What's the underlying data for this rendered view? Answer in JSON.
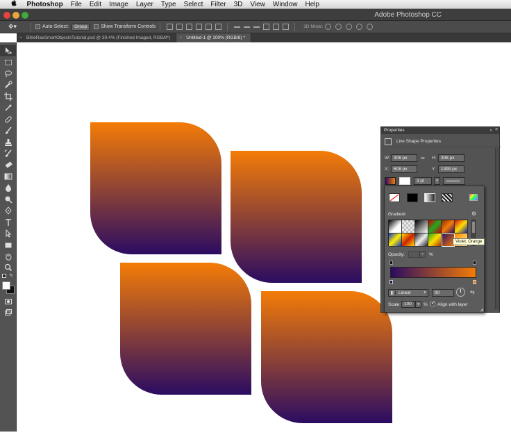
{
  "menubar": {
    "apple": "",
    "items": [
      "Photoshop",
      "File",
      "Edit",
      "Image",
      "Layer",
      "Type",
      "Select",
      "Filter",
      "3D",
      "View",
      "Window",
      "Help"
    ]
  },
  "window": {
    "title": "Adobe Photoshop CC"
  },
  "options": {
    "auto_select_label": "Auto-Select:",
    "auto_select_value": "Group",
    "show_transform_label": "Show Transform Controls",
    "mode_3d_label": "3D Mode:"
  },
  "tabs": [
    {
      "label": "BillieRaeSmartObjectsTutorial.psd @ 30.4% (Finished Imaged, RGB/8*)",
      "close": "×",
      "active": false
    },
    {
      "label": "Untitled-1 @ 100% (RGB/8) *",
      "close": "×",
      "active": true
    }
  ],
  "tools": [
    "move",
    "marquee",
    "lasso",
    "quick-selection",
    "crop",
    "eyedropper",
    "healing",
    "brush",
    "clone-stamp",
    "history-brush",
    "eraser",
    "gradient",
    "blur",
    "dodge",
    "pen",
    "type",
    "path-selection",
    "rectangle",
    "hand",
    "zoom"
  ],
  "colors": {
    "gradient_start": "#f47c07",
    "gradient_end": "#2b0c62",
    "panel_bg": "#535353",
    "toolbar_bg": "#535353"
  },
  "properties": {
    "header": "Properties",
    "expand_icon": "»",
    "menu_icon": "≡",
    "subtitle": "Live Shape Properties",
    "w_label": "W:",
    "w_value": "306 px",
    "h_label": "H:",
    "h_value": "306 px",
    "x_label": "X:",
    "x_value": "608 px",
    "y_label": "Y:",
    "y_value": "1399 px",
    "stroke_width": "3 pt"
  },
  "gradient_panel": {
    "title": "Gradient",
    "tooltip": "Violet, Orange",
    "opacity_label": "Opacity:",
    "opacity_unit": "%",
    "style_value": "Linear",
    "angle_value": "90",
    "scale_label": "Scale:",
    "scale_value": "100",
    "scale_unit": "%",
    "align_label": "Align with layer"
  }
}
